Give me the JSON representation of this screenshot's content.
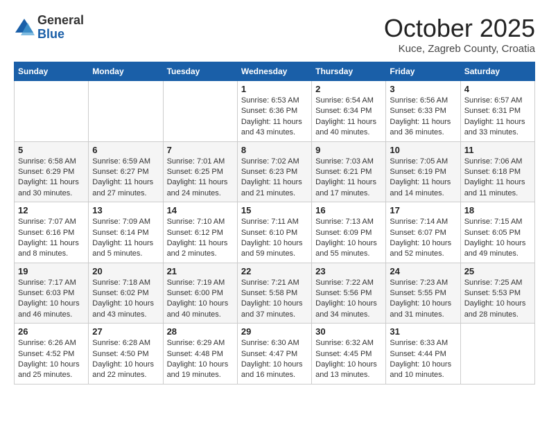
{
  "header": {
    "logo_general": "General",
    "logo_blue": "Blue",
    "month_title": "October 2025",
    "location": "Kuce, Zagreb County, Croatia"
  },
  "weekdays": [
    "Sunday",
    "Monday",
    "Tuesday",
    "Wednesday",
    "Thursday",
    "Friday",
    "Saturday"
  ],
  "weeks": [
    [
      {
        "day": "",
        "info": ""
      },
      {
        "day": "",
        "info": ""
      },
      {
        "day": "",
        "info": ""
      },
      {
        "day": "1",
        "info": "Sunrise: 6:53 AM\nSunset: 6:36 PM\nDaylight: 11 hours\nand 43 minutes."
      },
      {
        "day": "2",
        "info": "Sunrise: 6:54 AM\nSunset: 6:34 PM\nDaylight: 11 hours\nand 40 minutes."
      },
      {
        "day": "3",
        "info": "Sunrise: 6:56 AM\nSunset: 6:33 PM\nDaylight: 11 hours\nand 36 minutes."
      },
      {
        "day": "4",
        "info": "Sunrise: 6:57 AM\nSunset: 6:31 PM\nDaylight: 11 hours\nand 33 minutes."
      }
    ],
    [
      {
        "day": "5",
        "info": "Sunrise: 6:58 AM\nSunset: 6:29 PM\nDaylight: 11 hours\nand 30 minutes."
      },
      {
        "day": "6",
        "info": "Sunrise: 6:59 AM\nSunset: 6:27 PM\nDaylight: 11 hours\nand 27 minutes."
      },
      {
        "day": "7",
        "info": "Sunrise: 7:01 AM\nSunset: 6:25 PM\nDaylight: 11 hours\nand 24 minutes."
      },
      {
        "day": "8",
        "info": "Sunrise: 7:02 AM\nSunset: 6:23 PM\nDaylight: 11 hours\nand 21 minutes."
      },
      {
        "day": "9",
        "info": "Sunrise: 7:03 AM\nSunset: 6:21 PM\nDaylight: 11 hours\nand 17 minutes."
      },
      {
        "day": "10",
        "info": "Sunrise: 7:05 AM\nSunset: 6:19 PM\nDaylight: 11 hours\nand 14 minutes."
      },
      {
        "day": "11",
        "info": "Sunrise: 7:06 AM\nSunset: 6:18 PM\nDaylight: 11 hours\nand 11 minutes."
      }
    ],
    [
      {
        "day": "12",
        "info": "Sunrise: 7:07 AM\nSunset: 6:16 PM\nDaylight: 11 hours\nand 8 minutes."
      },
      {
        "day": "13",
        "info": "Sunrise: 7:09 AM\nSunset: 6:14 PM\nDaylight: 11 hours\nand 5 minutes."
      },
      {
        "day": "14",
        "info": "Sunrise: 7:10 AM\nSunset: 6:12 PM\nDaylight: 11 hours\nand 2 minutes."
      },
      {
        "day": "15",
        "info": "Sunrise: 7:11 AM\nSunset: 6:10 PM\nDaylight: 10 hours\nand 59 minutes."
      },
      {
        "day": "16",
        "info": "Sunrise: 7:13 AM\nSunset: 6:09 PM\nDaylight: 10 hours\nand 55 minutes."
      },
      {
        "day": "17",
        "info": "Sunrise: 7:14 AM\nSunset: 6:07 PM\nDaylight: 10 hours\nand 52 minutes."
      },
      {
        "day": "18",
        "info": "Sunrise: 7:15 AM\nSunset: 6:05 PM\nDaylight: 10 hours\nand 49 minutes."
      }
    ],
    [
      {
        "day": "19",
        "info": "Sunrise: 7:17 AM\nSunset: 6:03 PM\nDaylight: 10 hours\nand 46 minutes."
      },
      {
        "day": "20",
        "info": "Sunrise: 7:18 AM\nSunset: 6:02 PM\nDaylight: 10 hours\nand 43 minutes."
      },
      {
        "day": "21",
        "info": "Sunrise: 7:19 AM\nSunset: 6:00 PM\nDaylight: 10 hours\nand 40 minutes."
      },
      {
        "day": "22",
        "info": "Sunrise: 7:21 AM\nSunset: 5:58 PM\nDaylight: 10 hours\nand 37 minutes."
      },
      {
        "day": "23",
        "info": "Sunrise: 7:22 AM\nSunset: 5:56 PM\nDaylight: 10 hours\nand 34 minutes."
      },
      {
        "day": "24",
        "info": "Sunrise: 7:23 AM\nSunset: 5:55 PM\nDaylight: 10 hours\nand 31 minutes."
      },
      {
        "day": "25",
        "info": "Sunrise: 7:25 AM\nSunset: 5:53 PM\nDaylight: 10 hours\nand 28 minutes."
      }
    ],
    [
      {
        "day": "26",
        "info": "Sunrise: 6:26 AM\nSunset: 4:52 PM\nDaylight: 10 hours\nand 25 minutes."
      },
      {
        "day": "27",
        "info": "Sunrise: 6:28 AM\nSunset: 4:50 PM\nDaylight: 10 hours\nand 22 minutes."
      },
      {
        "day": "28",
        "info": "Sunrise: 6:29 AM\nSunset: 4:48 PM\nDaylight: 10 hours\nand 19 minutes."
      },
      {
        "day": "29",
        "info": "Sunrise: 6:30 AM\nSunset: 4:47 PM\nDaylight: 10 hours\nand 16 minutes."
      },
      {
        "day": "30",
        "info": "Sunrise: 6:32 AM\nSunset: 4:45 PM\nDaylight: 10 hours\nand 13 minutes."
      },
      {
        "day": "31",
        "info": "Sunrise: 6:33 AM\nSunset: 4:44 PM\nDaylight: 10 hours\nand 10 minutes."
      },
      {
        "day": "",
        "info": ""
      }
    ]
  ]
}
